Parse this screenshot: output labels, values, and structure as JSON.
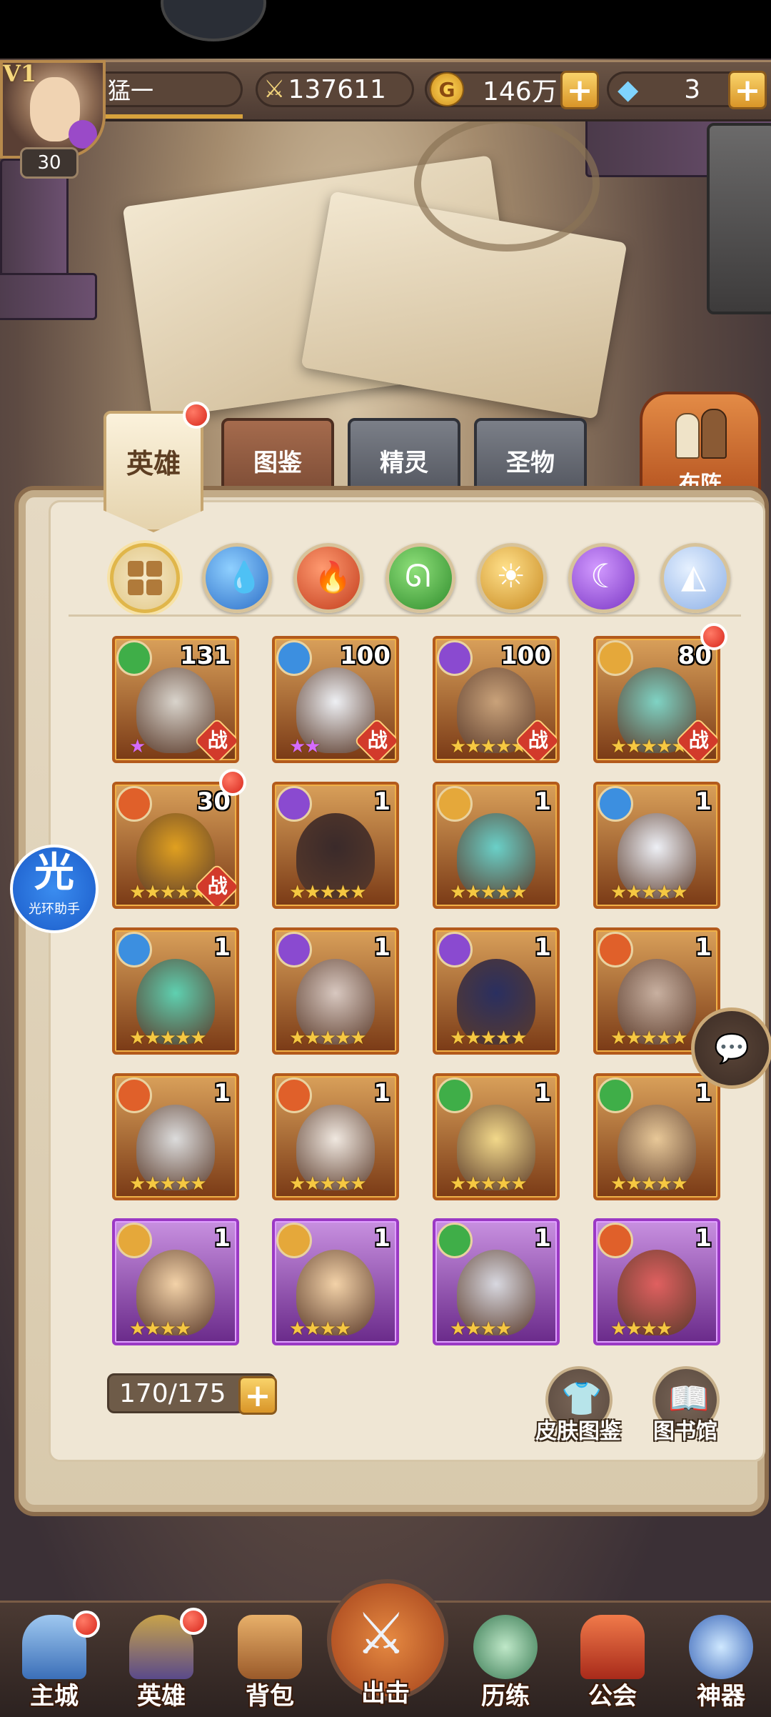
{
  "player": {
    "vip": "V1",
    "name": "猛一",
    "level": "30",
    "power": "137611",
    "gold": "146万",
    "diamonds": "3"
  },
  "tabs": [
    {
      "label": "英雄",
      "active": true
    },
    {
      "label": "图鉴"
    },
    {
      "label": "精灵"
    },
    {
      "label": "圣物"
    }
  ],
  "formation_button": "布阵",
  "elements": [
    "all-icon",
    "water-icon",
    "fire-icon",
    "wind-icon",
    "light-icon",
    "dark-icon",
    "mystic-icon"
  ],
  "heroes": [
    {
      "level": "131",
      "element": "wind",
      "stars": 1,
      "star_color": "purple",
      "battle": true,
      "frame": "orange"
    },
    {
      "level": "100",
      "element": "water",
      "stars": 2,
      "star_color": "purple",
      "battle": true,
      "frame": "orange"
    },
    {
      "level": "100",
      "element": "dark",
      "stars": 5,
      "battle": true,
      "frame": "orange"
    },
    {
      "level": "80",
      "element": "light",
      "stars": 5,
      "battle": true,
      "frame": "orange",
      "red_dot": true
    },
    {
      "level": "30",
      "element": "fire",
      "stars": 5,
      "battle": true,
      "frame": "orange",
      "red_dot": true
    },
    {
      "level": "1",
      "element": "dark",
      "stars": 5,
      "frame": "orange"
    },
    {
      "level": "1",
      "element": "light",
      "stars": 5,
      "frame": "orange"
    },
    {
      "level": "1",
      "element": "water",
      "stars": 5,
      "frame": "orange"
    },
    {
      "level": "1",
      "element": "water",
      "stars": 5,
      "frame": "orange"
    },
    {
      "level": "1",
      "element": "dark",
      "stars": 5,
      "frame": "orange"
    },
    {
      "level": "1",
      "element": "dark",
      "stars": 5,
      "frame": "orange"
    },
    {
      "level": "1",
      "element": "fire",
      "stars": 5,
      "frame": "orange"
    },
    {
      "level": "1",
      "element": "fire",
      "stars": 5,
      "frame": "orange"
    },
    {
      "level": "1",
      "element": "fire",
      "stars": 5,
      "frame": "orange"
    },
    {
      "level": "1",
      "element": "wind",
      "stars": 5,
      "frame": "orange"
    },
    {
      "level": "1",
      "element": "wind",
      "stars": 5,
      "frame": "orange"
    },
    {
      "level": "1",
      "element": "light",
      "stars": 4,
      "frame": "purple"
    },
    {
      "level": "1",
      "element": "light",
      "stars": 4,
      "frame": "purple"
    },
    {
      "level": "1",
      "element": "wind",
      "stars": 4,
      "frame": "purple"
    },
    {
      "level": "1",
      "element": "fire",
      "stars": 4,
      "frame": "purple"
    }
  ],
  "battle_label": "战",
  "hero_count": "170/175",
  "buttons": {
    "skins": "皮肤图鉴",
    "library": "图书馆"
  },
  "helper": {
    "glyph": "光",
    "label": "光环助手"
  },
  "nav": [
    {
      "label": "主城",
      "red_dot": true
    },
    {
      "label": "英雄",
      "red_dot": true
    },
    {
      "label": "背包"
    },
    {
      "label": "出击"
    },
    {
      "label": "历练"
    },
    {
      "label": "公会"
    },
    {
      "label": "神器"
    }
  ],
  "colors": {
    "water": "#3c8fe0",
    "fire": "#e0602a",
    "wind": "#3fae48",
    "light": "#e5a83a",
    "dark": "#8a4ad0",
    "mystic": "#8fb5e8"
  }
}
